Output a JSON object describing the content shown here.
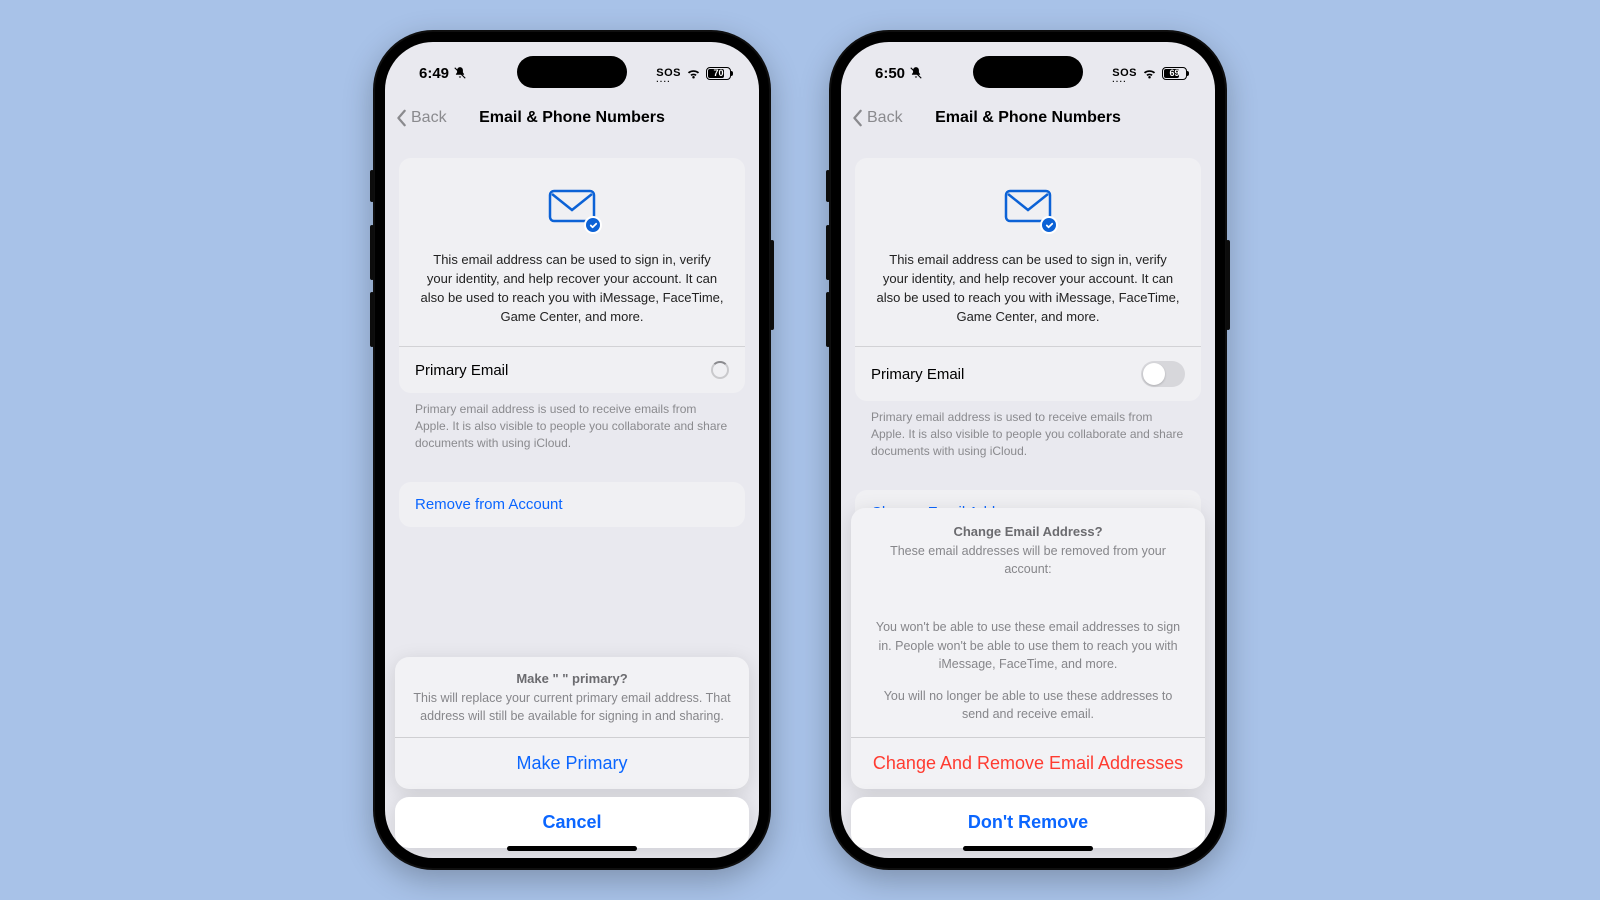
{
  "left": {
    "status": {
      "time": "6:49",
      "sos": "SOS",
      "battery": "70",
      "battery_pct": 70
    },
    "nav": {
      "back": "Back",
      "title": "Email & Phone Numbers"
    },
    "hero_text": "This email address can be used to sign in, verify your identity, and help recover your account. It can also be used to reach you with iMessage, FaceTime, Game Center, and more.",
    "primary_label": "Primary Email",
    "primary_footnote": "Primary email address is used to receive emails from Apple. It is also visible to people you collaborate and share documents with using iCloud.",
    "remove_label": "Remove from Account",
    "sheet": {
      "title": "Make \"                                   \" primary?",
      "sub": "This will replace your current primary email address. That address will still be available for signing in and sharing.",
      "action": "Make Primary",
      "cancel": "Cancel"
    }
  },
  "right": {
    "status": {
      "time": "6:50",
      "sos": "SOS",
      "battery": "69",
      "battery_pct": 69
    },
    "nav": {
      "back": "Back",
      "title": "Email & Phone Numbers"
    },
    "hero_text": "This email address can be used to sign in, verify your identity, and help recover your account. It can also be used to reach you with iMessage, FaceTime, Game Center, and more.",
    "primary_label": "Primary Email",
    "primary_footnote": "Primary email address is used to receive emails from Apple. It is also visible to people you collaborate and share documents with using iCloud.",
    "change_label": "Change Email Address",
    "sheet": {
      "title": "Change Email Address?",
      "sub": "These email addresses will be removed from your account:",
      "p1": "You won't be able to use these email addresses to sign in. People won't be able to use them to reach you with iMessage, FaceTime, and more.",
      "p2": "You will no longer be able to use these addresses to send and receive email.",
      "action": "Change And Remove Email Addresses",
      "cancel": "Don't Remove"
    }
  }
}
